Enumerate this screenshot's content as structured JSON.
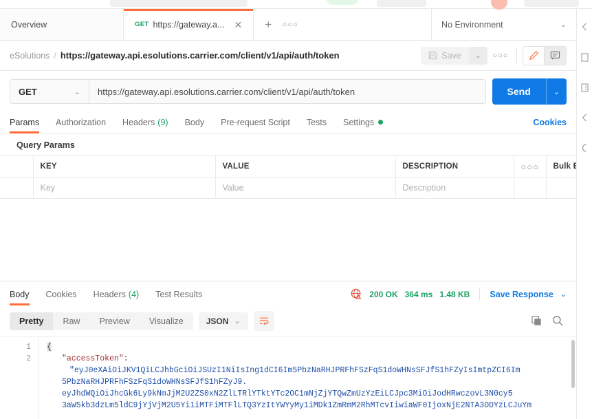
{
  "tabs": {
    "overview_label": "Overview",
    "request_tab": {
      "method": "GET",
      "label": "https://gateway.a...",
      "close": "✕"
    },
    "add_label": "+",
    "more_label": "○○○",
    "environment": {
      "value": "No Environment",
      "caret": "⌄"
    }
  },
  "breadcrumb": {
    "collection": "eSolutions",
    "separator": "/",
    "request_name": "https://gateway.api.esolutions.carrier.com/client/v1/api/auth/token",
    "save_label": "Save",
    "save_caret": "⌄",
    "more_label": "○○○"
  },
  "url_bar": {
    "method": "GET",
    "method_caret": "⌄",
    "url": "https://gateway.api.esolutions.carrier.com/client/v1/api/auth/token",
    "send_label": "Send",
    "send_caret": "⌄"
  },
  "request_tabs": {
    "items": [
      {
        "label": "Params",
        "count": "",
        "active": true
      },
      {
        "label": "Authorization",
        "count": "",
        "active": false
      },
      {
        "label": "Headers",
        "count": "(9)",
        "active": false
      },
      {
        "label": "Body",
        "count": "",
        "active": false
      },
      {
        "label": "Pre-request Script",
        "count": "",
        "active": false
      },
      {
        "label": "Tests",
        "count": "",
        "active": false
      },
      {
        "label": "Settings",
        "count": "",
        "active": false
      }
    ],
    "cookies_label": "Cookies"
  },
  "query_params": {
    "title": "Query Params",
    "headers": {
      "key": "KEY",
      "value": "VALUE",
      "description": "DESCRIPTION",
      "more": "○○○",
      "bulk_edit": "Bulk Edit"
    },
    "rows": [
      {
        "key": "Key",
        "value": "Value",
        "description": "Description"
      }
    ]
  },
  "response": {
    "tabs": [
      {
        "label": "Body",
        "count": "",
        "active": true
      },
      {
        "label": "Cookies",
        "count": "",
        "active": false
      },
      {
        "label": "Headers",
        "count": "(4)",
        "active": false
      },
      {
        "label": "Test Results",
        "count": "",
        "active": false
      }
    ],
    "status": "200 OK",
    "time": "364 ms",
    "size": "1.48 KB",
    "save_response": "Save Response",
    "save_response_caret": "⌄",
    "view_modes": [
      {
        "label": "Pretty",
        "active": true
      },
      {
        "label": "Raw",
        "active": false
      },
      {
        "label": "Preview",
        "active": false
      },
      {
        "label": "Visualize",
        "active": false
      }
    ],
    "format": "JSON",
    "format_caret": "⌄"
  },
  "code": {
    "line_numbers": [
      "1",
      "2"
    ],
    "line1": "{",
    "line2_key": "\"accessToken\"",
    "line2_colon": ":",
    "token_line1": "\"eyJ0eXAiOiJKV1QiLCJhbGciOiJSUzI1NiIsIng1dCI6Im5PbzNaRHJPRFhFSzFqS1doWHNsSFJfS1hFZyIsImtpZCI6Im",
    "token_line2": "5PbzNaRHJPRFhFSzFqS1doWHNsSFJfS1hFZyJ9.",
    "token_line3": "eyJhdWQiOiJhcGk6Ly9kNmJjM2U2ZS0xN2ZlLTRlYTktYTc2OC1mNjZjYTQwZmUzYzEiLCJpc3MiOiJodHRwczovL3N0cy5",
    "token_line4": "3aW5kb3dzLm5ldC9jYjVjM2U5Yi1iMTFiMTFlLTQ3YzItYWYyMy1iMDk1ZmRmM2RhMTcvIiwiaWF0IjoxNjE2NTA3ODYzLCJuYm"
  }
}
